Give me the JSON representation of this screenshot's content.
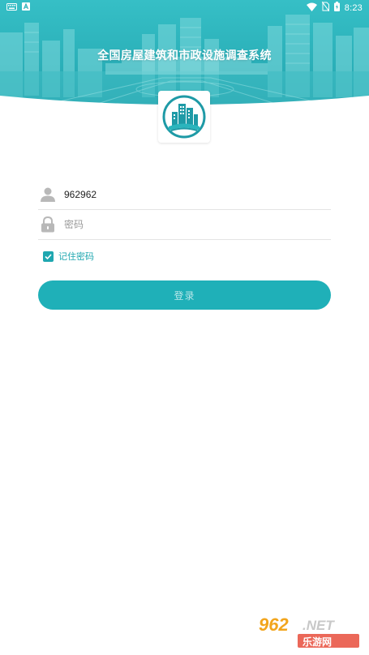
{
  "status_bar": {
    "time": "8:23",
    "left_icons": [
      "keyboard-icon",
      "a-badge-icon"
    ],
    "right_icons": [
      "wifi-icon",
      "no-sim-icon",
      "battery-icon"
    ]
  },
  "header": {
    "title": "全国房屋建筑和市政设施调查系统"
  },
  "logo": {
    "icon": "city-building-logo-icon"
  },
  "login_form": {
    "username_value": "962962",
    "username_icon": "user-icon",
    "password_placeholder": "密码",
    "password_icon": "lock-icon",
    "remember_label": "记住密码",
    "remember_checked": true,
    "login_button_label": "登录"
  },
  "colors": {
    "accent": "#1fa7b0",
    "button": "#1fb0b8",
    "header_teal": "#2bb5bd"
  },
  "watermark": {
    "text_top": "962.NET",
    "text_bottom": "乐游网"
  }
}
